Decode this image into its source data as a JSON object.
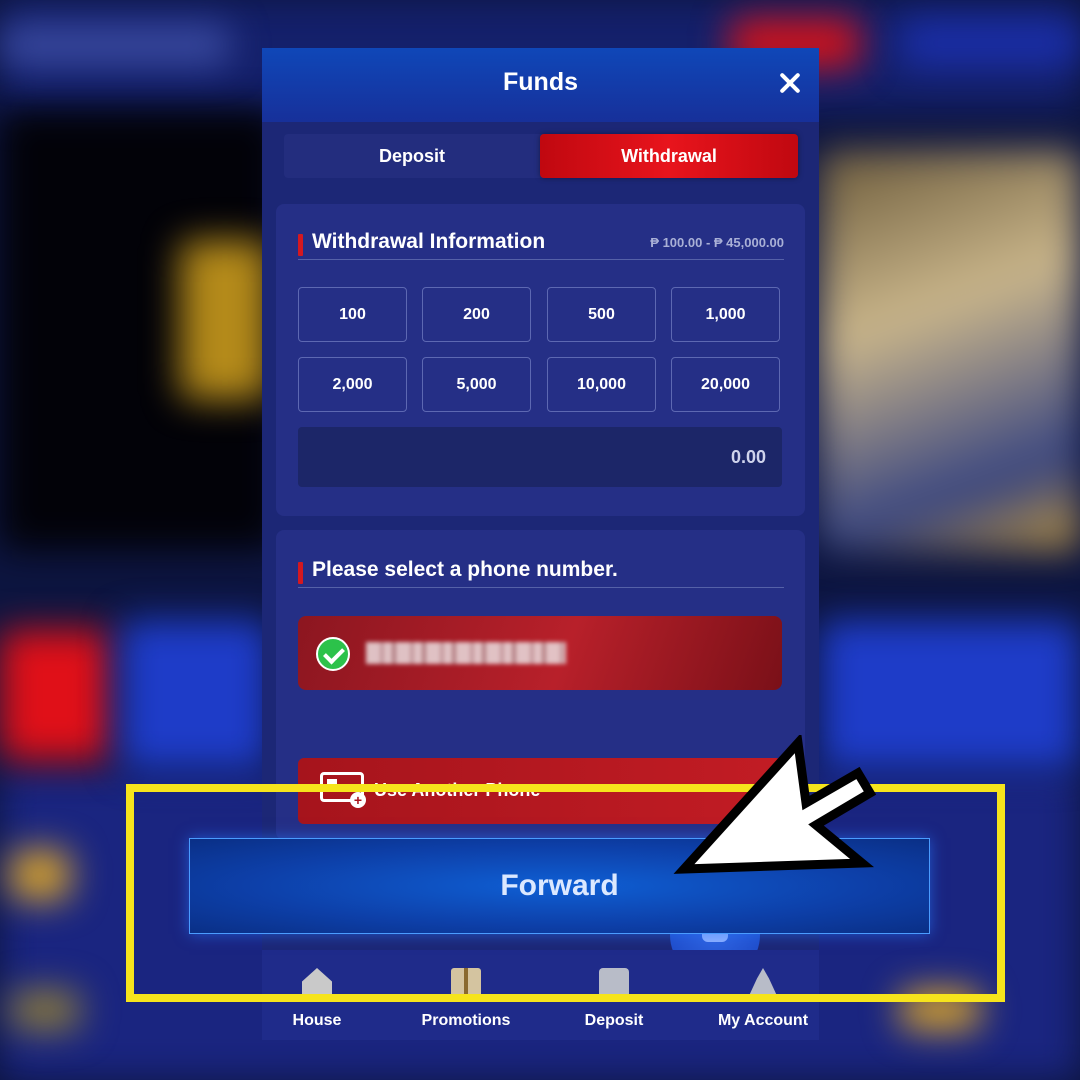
{
  "modal": {
    "title": "Funds",
    "tabs": [
      {
        "label": "Deposit",
        "active": false
      },
      {
        "label": "Withdrawal",
        "active": true
      }
    ]
  },
  "withdrawal_info": {
    "title": "Withdrawal Information",
    "range": "₱ 100.00 - ₱ 45,000.00",
    "amounts": [
      "100",
      "200",
      "500",
      "1,000",
      "2,000",
      "5,000",
      "10,000",
      "20,000"
    ],
    "amount_value": "0.00"
  },
  "phone_section": {
    "title": "Please select a phone number.",
    "selected_phone_icon": "check-icon",
    "another_phone_label": "Use Another Phone"
  },
  "forward_button": {
    "label": "Forward"
  },
  "bottom_nav": [
    {
      "label": "House",
      "icon": "house-icon"
    },
    {
      "label": "Promotions",
      "icon": "gift-icon"
    },
    {
      "label": "Deposit",
      "icon": "deposit-icon"
    },
    {
      "label": "My Account",
      "icon": "account-icon"
    }
  ],
  "colors": {
    "active_tab": "#e8141c",
    "highlight": "#f6e41c",
    "modal_bg": "#1c2776"
  }
}
